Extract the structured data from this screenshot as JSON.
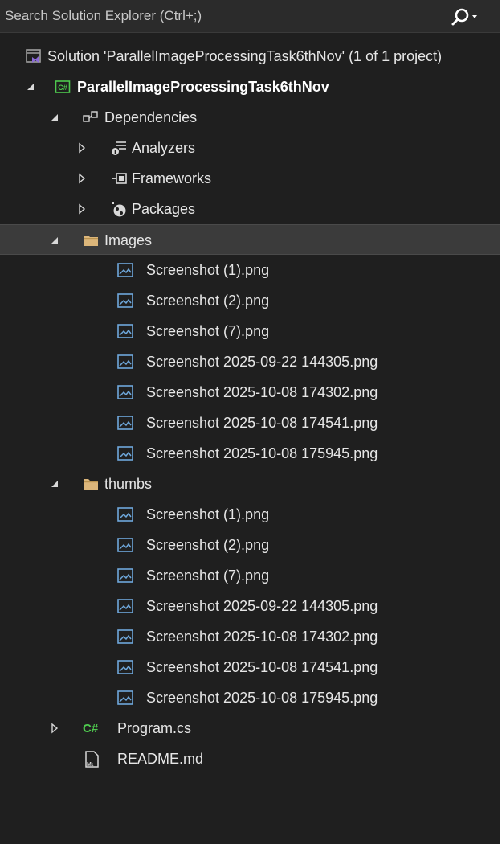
{
  "search": {
    "placeholder": "Search Solution Explorer (Ctrl+;)",
    "search_icon": "search-icon",
    "dropdown_icon": "chevron-down-icon"
  },
  "tree": {
    "solution": {
      "label": "Solution 'ParallelImageProcessingTask6thNov' (1 of 1 project)",
      "icon": "solution-icon"
    },
    "project": {
      "label": "ParallelImageProcessingTask6thNov",
      "icon": "csharp-project-icon",
      "expanded": true
    },
    "dependencies": {
      "label": "Dependencies",
      "icon": "dependencies-icon",
      "expanded": true,
      "items": [
        {
          "label": "Analyzers",
          "icon": "analyzer-icon"
        },
        {
          "label": "Frameworks",
          "icon": "framework-icon"
        },
        {
          "label": "Packages",
          "icon": "package-icon"
        }
      ]
    },
    "images": {
      "label": "Images",
      "icon": "folder-icon",
      "expanded": true,
      "selected": true,
      "files": [
        "Screenshot (1).png",
        "Screenshot (2).png",
        "Screenshot (7).png",
        "Screenshot 2025-09-22 144305.png",
        "Screenshot 2025-10-08 174302.png",
        "Screenshot 2025-10-08 174541.png",
        "Screenshot 2025-10-08 175945.png"
      ]
    },
    "thumbs": {
      "label": "thumbs",
      "icon": "folder-icon",
      "expanded": true,
      "files": [
        "Screenshot (1).png",
        "Screenshot (2).png",
        "Screenshot (7).png",
        "Screenshot 2025-09-22 144305.png",
        "Screenshot 2025-10-08 174302.png",
        "Screenshot 2025-10-08 174541.png",
        "Screenshot 2025-10-08 175945.png"
      ]
    },
    "program": {
      "label": "Program.cs",
      "icon": "csharp-file-icon",
      "expanded": false
    },
    "readme": {
      "label": "README.md",
      "icon": "markdown-file-icon"
    }
  },
  "colors": {
    "background": "#1f1f1f",
    "search_background": "#2b2b2b",
    "selected_row": "#3b3b3b",
    "text": "#e6e6e6",
    "folder": "#dcb67a",
    "csharp_green": "#4ec94e",
    "image_icon": "#6fa8dc"
  }
}
